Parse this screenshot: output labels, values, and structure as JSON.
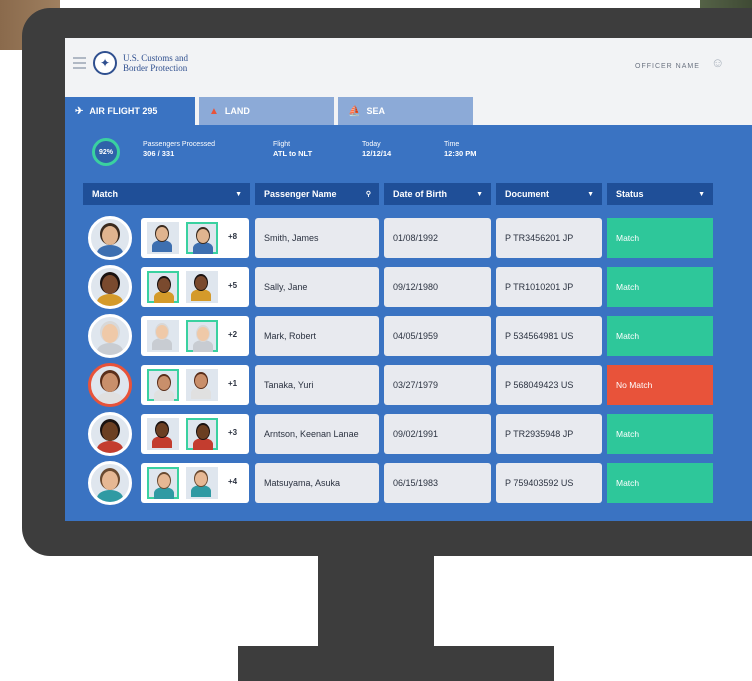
{
  "header": {
    "agency_line1": "U.S. Customs and",
    "agency_line2": "Border Protection",
    "officer_label": "OFFICER NAME"
  },
  "tabs": [
    {
      "label": "AIR FLIGHT 295",
      "icon": "plane-icon",
      "active": true
    },
    {
      "label": "LAND",
      "icon": "building-icon",
      "active": false
    },
    {
      "label": "SEA",
      "icon": "ship-icon",
      "active": false
    }
  ],
  "summary": {
    "progress_percent": "92%",
    "processed_label": "Passengers Processed",
    "processed_value": "306 / 331",
    "flight_label": "Flight",
    "flight_value": "ATL to NLT",
    "today_label": "Today",
    "today_value": "12/12/14",
    "time_label": "Time",
    "time_value": "12:30 PM"
  },
  "columns": [
    "Match",
    "Passenger Name",
    "Date of Birth",
    "Document",
    "Status"
  ],
  "colors": {
    "accent_blue": "#3a73c2",
    "header_blue": "#1f4f98",
    "match_green": "#2ec79a",
    "no_match_red": "#e8533a"
  },
  "rows": [
    {
      "extra": "+8",
      "name": "Smith, James",
      "dob": "01/08/1992",
      "document": "P TR3456201 JP",
      "status": "Match"
    },
    {
      "extra": "+5",
      "name": "Sally, Jane",
      "dob": "09/12/1980",
      "document": "P TR1010201 JP",
      "status": "Match"
    },
    {
      "extra": "+2",
      "name": "Mark, Robert",
      "dob": "04/05/1959",
      "document": "P 534564981 US",
      "status": "Match"
    },
    {
      "extra": "+1",
      "name": "Tanaka, Yuri",
      "dob": "03/27/1979",
      "document": "P 568049423 US",
      "status": "No Match"
    },
    {
      "extra": "+3",
      "name": "Arntson, Keenan Lanae",
      "dob": "09/02/1991",
      "document": "P TR2935948 JP",
      "status": "Match"
    },
    {
      "extra": "+4",
      "name": "Matsuyama, Asuka",
      "dob": "06/15/1983",
      "document": "P 759403592 US",
      "status": "Match"
    }
  ]
}
